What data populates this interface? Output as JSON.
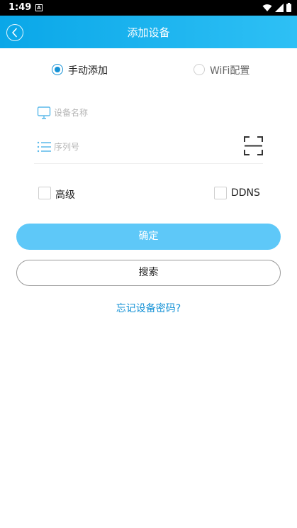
{
  "status_bar": {
    "time": "1:49",
    "notification_letter": "A"
  },
  "header": {
    "title": "添加设备"
  },
  "mode": {
    "manual_label": "手动添加",
    "wifi_label": "WiFi配置",
    "selected": "manual"
  },
  "form": {
    "device_name_placeholder": "设备名称",
    "serial_placeholder": "序列号"
  },
  "options": {
    "advanced_label": "高级",
    "ddns_label": "DDNS"
  },
  "actions": {
    "confirm_label": "确定",
    "search_label": "搜索",
    "forgot_password_label": "忘记设备密码?"
  },
  "colors": {
    "header_start": "#0aa7e8",
    "header_end": "#2ec0f5",
    "accent": "#1592d6",
    "confirm_button": "#5ec8f8"
  }
}
